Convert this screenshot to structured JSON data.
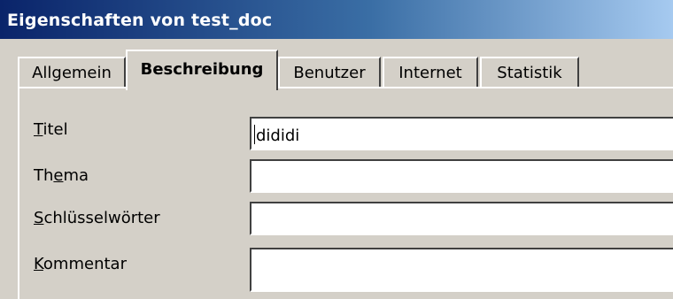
{
  "window": {
    "title": "Eigenschaften von test_doc"
  },
  "tabs": [
    {
      "label": "Allgemein",
      "active": false
    },
    {
      "label": "Beschreibung",
      "active": true
    },
    {
      "label": "Benutzer",
      "active": false
    },
    {
      "label": "Internet",
      "active": false
    },
    {
      "label": "Statistik",
      "active": false
    }
  ],
  "form": {
    "titel": {
      "label_accel": "T",
      "label_rest": "itel",
      "value": "dididi"
    },
    "thema": {
      "label_pre": "Th",
      "label_accel": "e",
      "label_rest": "ma",
      "value": ""
    },
    "schluessel": {
      "label_accel": "S",
      "label_rest": "chlüsselwörter",
      "value": ""
    },
    "kommentar": {
      "label_accel": "K",
      "label_rest": "ommentar",
      "value": ""
    }
  }
}
